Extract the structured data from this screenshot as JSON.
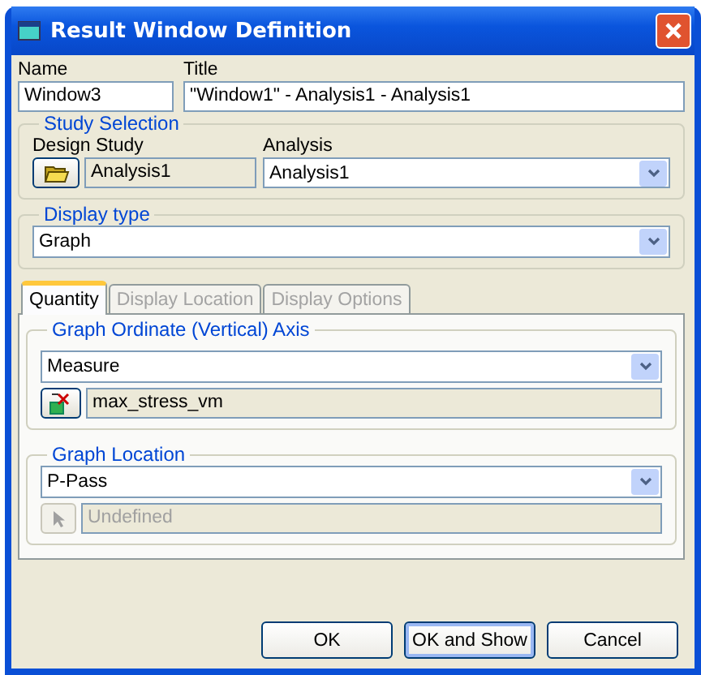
{
  "window": {
    "title": "Result Window Definition"
  },
  "name_field": {
    "label": "Name",
    "value": "Window3"
  },
  "title_field": {
    "label": "Title",
    "value": "\"Window1\" - Analysis1 - Analysis1"
  },
  "study_selection": {
    "legend": "Study Selection",
    "design_study": {
      "label": "Design Study",
      "value": "Analysis1"
    },
    "analysis": {
      "label": "Analysis",
      "value": "Analysis1"
    }
  },
  "display_type": {
    "legend": "Display type",
    "value": "Graph"
  },
  "tabs": [
    {
      "label": "Quantity",
      "selected": true,
      "disabled": false
    },
    {
      "label": "Display Location",
      "selected": false,
      "disabled": true
    },
    {
      "label": "Display Options",
      "selected": false,
      "disabled": true
    }
  ],
  "ordinate_axis": {
    "legend": "Graph Ordinate (Vertical) Axis",
    "value": "Measure",
    "measure": "max_stress_vm"
  },
  "graph_location": {
    "legend": "Graph Location",
    "value": "P-Pass",
    "entity": {
      "value": "Undefined",
      "disabled": true
    }
  },
  "buttons": [
    {
      "label": "OK",
      "focused": false
    },
    {
      "label": "OK and Show",
      "focused": true
    },
    {
      "label": "Cancel",
      "focused": false
    }
  ]
}
